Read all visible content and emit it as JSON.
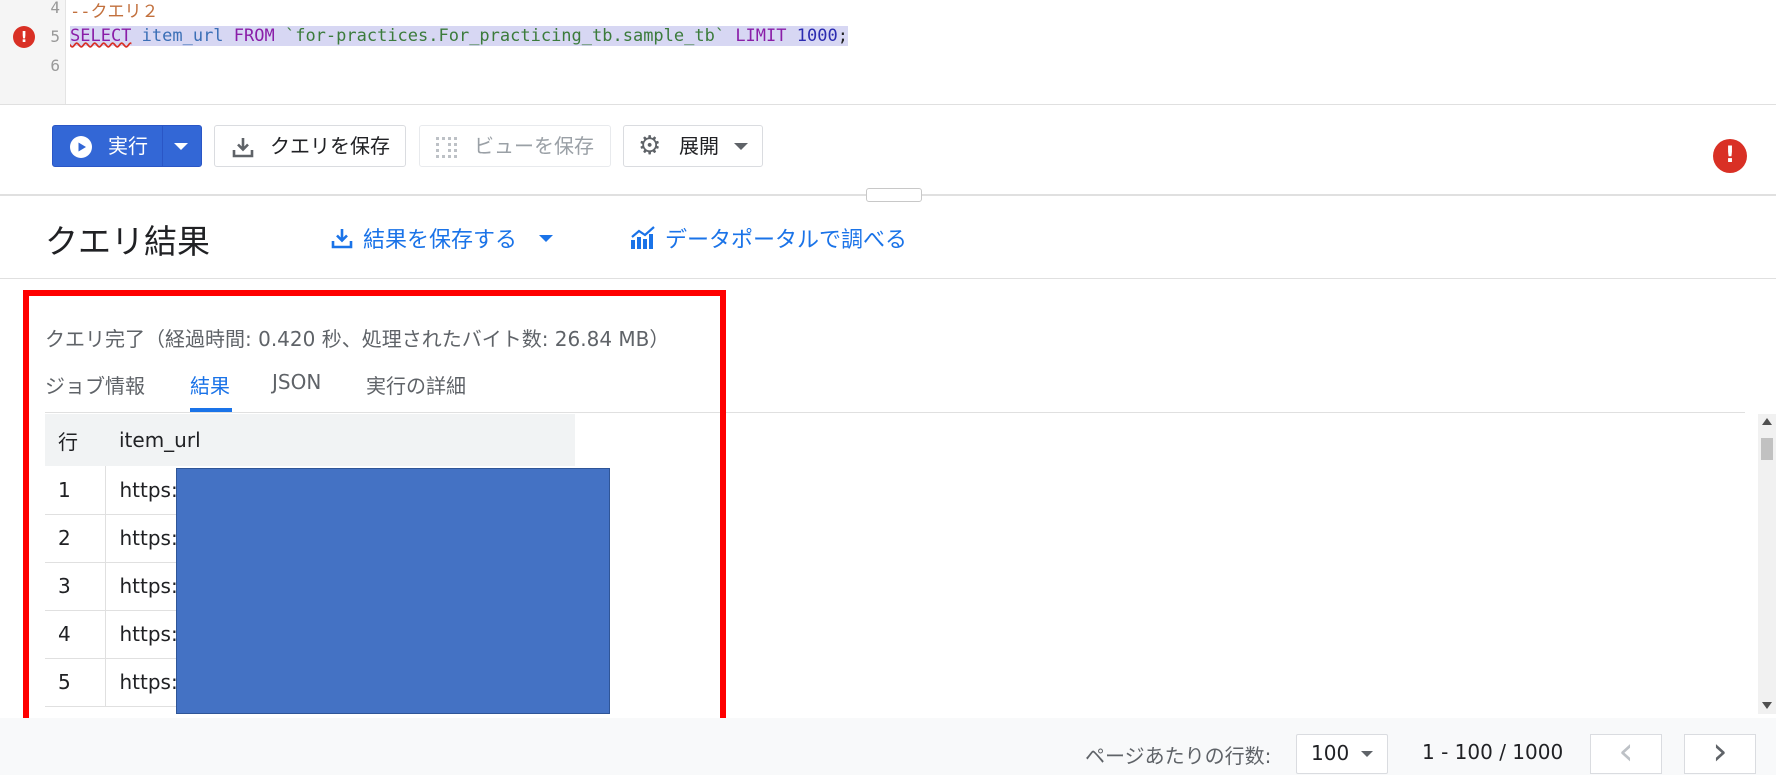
{
  "editor": {
    "lines": [
      {
        "num": "4",
        "comment": "--クエリ２"
      },
      {
        "num": "5",
        "kw_select": "SELECT",
        "col": " item_url ",
        "kw_from": "FROM",
        "table": " `for-practices.For_practicing_tb.sample_tb` ",
        "kw_limit": "LIMIT",
        "limit_val": " 1000",
        "semi": ";"
      },
      {
        "num": "6"
      }
    ],
    "error_glyph": "!"
  },
  "toolbar": {
    "run_label": "実行",
    "save_query_label": "クエリを保存",
    "save_view_label": "ビューを保存",
    "deploy_label": "展開",
    "error_glyph": "!"
  },
  "results": {
    "title": "クエリ結果",
    "save_results_label": "結果を保存する",
    "explore_label": "データポータルで調べる",
    "status": "クエリ完了（経過時間: 0.420 秒、処理されたバイト数: 26.84 MB）",
    "tabs": [
      "ジョブ情報",
      "結果",
      "JSON",
      "実行の詳細"
    ],
    "table": {
      "headers": [
        "行",
        "item_url"
      ],
      "rows": [
        {
          "n": "1",
          "url": "https:/"
        },
        {
          "n": "2",
          "url": "https:/"
        },
        {
          "n": "3",
          "url": "https:/"
        },
        {
          "n": "4",
          "url": "https:/"
        },
        {
          "n": "5",
          "url": "https:/"
        }
      ]
    }
  },
  "pagination": {
    "rows_per_page_label": "ページあたりの行数:",
    "rows_per_page_value": "100",
    "range": "1 - 100 / 1000",
    "prev_glyph": "‹",
    "next_glyph": "›"
  },
  "colors": {
    "primary": "#3367d6",
    "link": "#1a73e8",
    "error": "#d93025",
    "highlight_box": "#ff0000",
    "redaction": "#4472c4"
  }
}
